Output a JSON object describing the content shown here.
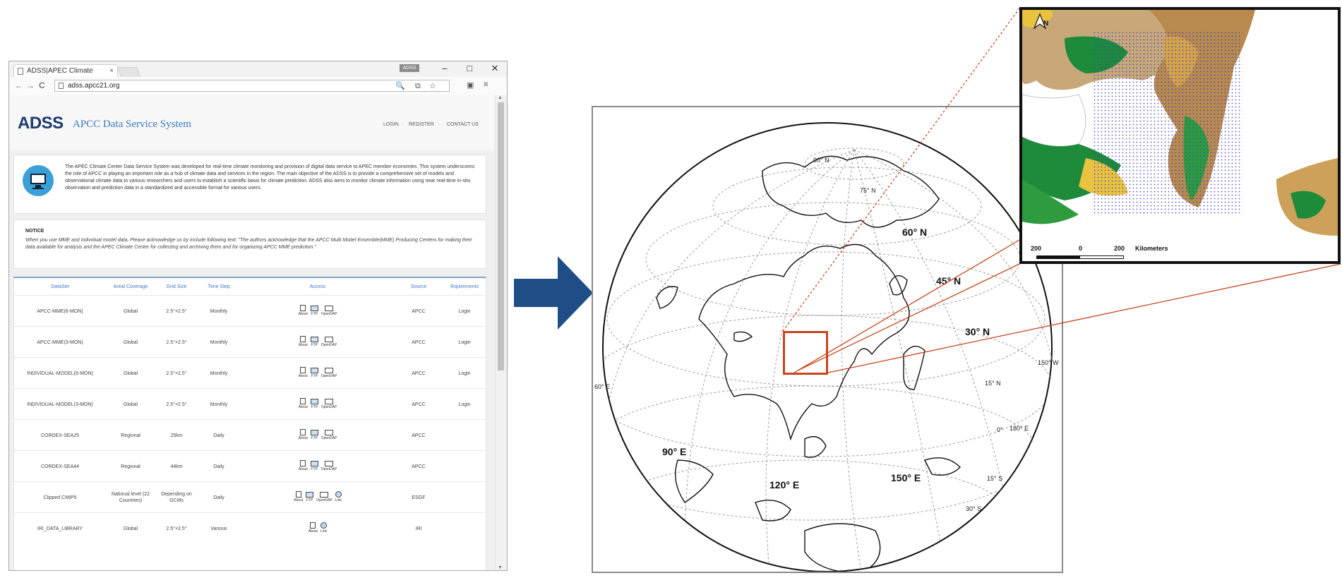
{
  "browser": {
    "tab_title": "ADSS|APEC Climate",
    "tab_close": "×",
    "badge": "ADSS",
    "minimize": "–",
    "maximize": "□",
    "close": "✕",
    "back": "←",
    "forward": "→",
    "reload": "C",
    "url": "adss.apcc21.org"
  },
  "site": {
    "logo": "ADSS",
    "subtitle": "APCC Data Service System",
    "nav": [
      "LOGIN",
      "REGISTER",
      "CONTACT US"
    ],
    "intro": "The APEC Climate Center Data Service System was developed for real-time climate monitoring and provision of digital data service to APEC member economies. This system underscores the role of APCC in playing an important role as a hub of climate data and services in the region. The main objective of the ADSS is to provide a comprehensive set of models and observational climate data to various researchers and users to establish a scientific basis for climate prediction. ADSS also aims to monitor climate information using near real-time in-situ observation and prediction data in a standardized and accessible format for various users.",
    "notice_title": "NOTICE",
    "notice_text": "When you use MME and individual model data, Please acknowledge us by include following text: \"The authors acknowledge that the APCC Multi Model Ensemble(MME) Producing Centers for making their data available for analysis and the APEC Climate Center for collecting and archiving them and for organizing APCC MME prediction.\""
  },
  "table": {
    "headers": [
      "DataSet",
      "Areal Coverage",
      "Grid Size",
      "Time Step",
      "Access",
      "Source",
      "Rquirements"
    ],
    "rows": [
      {
        "dataset": "APCC-MME(6-MON)",
        "coverage": "Global",
        "grid": "2.5°×2.5°",
        "step": "Monthly",
        "access": [
          "About",
          "FTP",
          "OpenDAP"
        ],
        "source": "APCC",
        "req": "Login"
      },
      {
        "dataset": "APCC-MME(3-MON)",
        "coverage": "Global",
        "grid": "2.5°×2.5°",
        "step": "Monthly",
        "access": [
          "About",
          "FTP",
          "OpenDAP"
        ],
        "source": "APCC",
        "req": "Login"
      },
      {
        "dataset": "INDIVIDUAL-MODEL(6-MON)",
        "coverage": "Global",
        "grid": "2.5°×2.5°",
        "step": "Monthly",
        "access": [
          "About",
          "FTP",
          "OpenDAP"
        ],
        "source": "APCC",
        "req": "Login"
      },
      {
        "dataset": "INDIVIDUAL-MODEL(3-MON)",
        "coverage": "Global",
        "grid": "2.5°×2.5°",
        "step": "Monthly",
        "access": [
          "About",
          "FTP",
          "OpenDAP"
        ],
        "source": "APCC",
        "req": "Login"
      },
      {
        "dataset": "CORDEX-SEA25",
        "coverage": "Regional",
        "grid": "25km",
        "step": "Daily",
        "access": [
          "About",
          "FTP",
          "OpenDAP"
        ],
        "source": "APCC",
        "req": ""
      },
      {
        "dataset": "CORDEX-SEA44",
        "coverage": "Regional",
        "grid": "44km",
        "step": "Daily",
        "access": [
          "About",
          "FTP",
          "OpenDAP"
        ],
        "source": "APCC",
        "req": ""
      },
      {
        "dataset": "Clipped CMIP5",
        "coverage": "National level (22 Countries)",
        "grid": "Depending on GCMs",
        "step": "Daily",
        "access": [
          "About",
          "FTP",
          "OpenDAP",
          "Link"
        ],
        "source": "ESGF",
        "req": ""
      },
      {
        "dataset": "IRI_DATA_LIBRARY",
        "coverage": "Global",
        "grid": "2.5°×2.5°",
        "step": "Various",
        "access": [
          "About",
          "Link"
        ],
        "source": "IRI",
        "req": ""
      }
    ]
  },
  "globe": {
    "labels_big": [
      "60° N",
      "45° N",
      "30° N",
      "90° E",
      "120° E",
      "150° E"
    ],
    "labels_small": [
      "90° N",
      "75° N",
      "15° N",
      "0°",
      "180° E",
      "15° S",
      "30° S",
      "150° W",
      "60° E"
    ]
  },
  "inset": {
    "north": "N",
    "scale": [
      "200",
      "0",
      "200",
      "Kilometers"
    ]
  },
  "colors": {
    "logo": "#1d3a6e",
    "accent": "#3d78c2",
    "arrow": "#1f4e86",
    "selection": "#c9441d"
  }
}
